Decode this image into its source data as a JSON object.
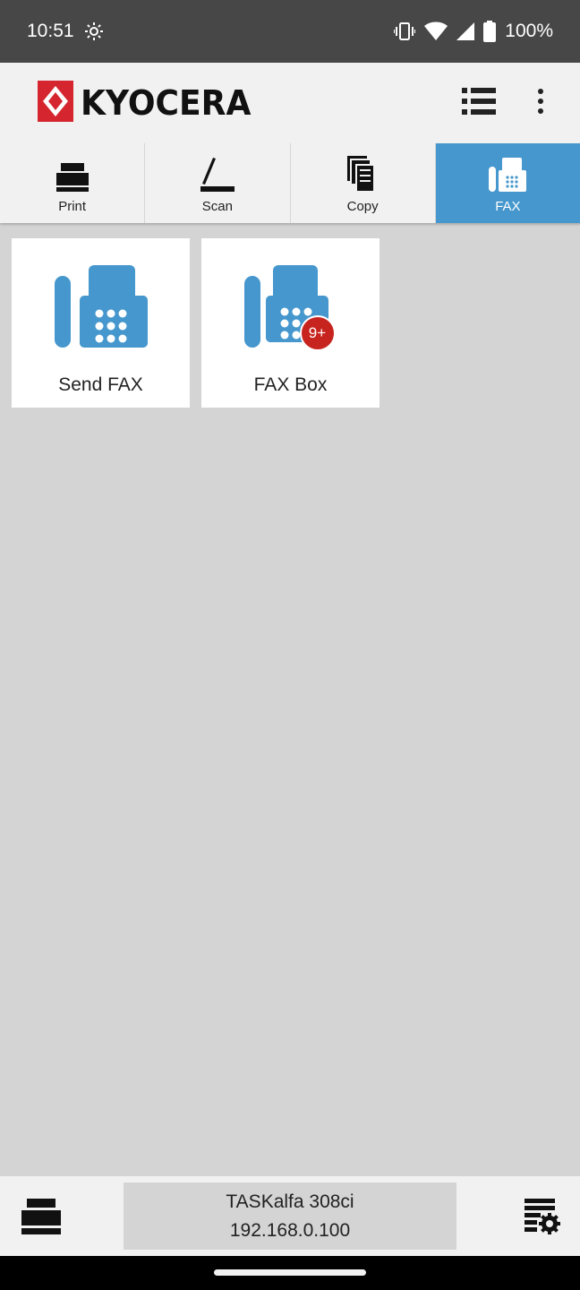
{
  "status_bar": {
    "time": "10:51",
    "battery": "100%",
    "icons": [
      "settings-gear-icon",
      "vibrate-icon",
      "wifi-icon",
      "signal-icon",
      "battery-icon"
    ]
  },
  "header": {
    "brand": "KYOCERA",
    "icons": [
      "kyocera-logo-icon",
      "list-view-icon",
      "more-vert-icon"
    ],
    "colors": {
      "logo_red": "#d5262f"
    }
  },
  "tabs": [
    {
      "label": "Print",
      "icon": "printer-icon",
      "active": false
    },
    {
      "label": "Scan",
      "icon": "scanner-icon",
      "active": false
    },
    {
      "label": "Copy",
      "icon": "copy-icon",
      "active": false
    },
    {
      "label": "FAX",
      "icon": "fax-icon",
      "active": true
    }
  ],
  "tiles": [
    {
      "label": "Send FAX",
      "icon": "fax-machine-icon"
    },
    {
      "label": "FAX Box",
      "icon": "fax-machine-icon",
      "badge": "9+"
    }
  ],
  "device": {
    "name": "TASKalfa 308ci",
    "ip": "192.168.0.100"
  },
  "colors": {
    "accent": "#4597cd",
    "badge_red": "#c8241f",
    "background": "#d4d4d4"
  }
}
